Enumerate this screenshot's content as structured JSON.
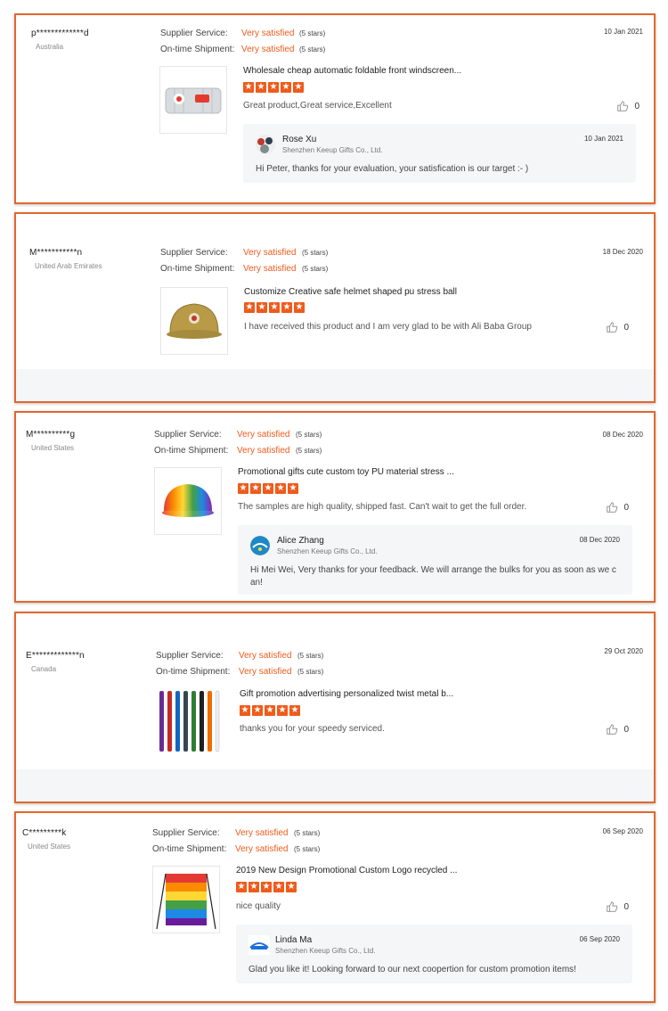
{
  "common": {
    "supplier_label": "Supplier Service:",
    "shipment_label": "On-time Shipment:",
    "satisfied": "Very satisfied",
    "stars_note": "(5 stars)",
    "star_glyph": "★",
    "like_icon": "thumbs-up-icon",
    "accent_color": "#ef5b1c",
    "border_color": "#e2672e"
  },
  "reviews": [
    {
      "user": "p*************d",
      "country": "Australia",
      "date": "10 Jan 2021",
      "product": "Wholesale cheap automatic foldable front windscreen...",
      "comment": "Great product,Great service,Excellent",
      "likes": "0",
      "reply": {
        "name": "Rose Xu",
        "company": "Shenzhen Keeup Gifts Co., Ltd.",
        "date": "10 Jan 2021",
        "text": "Hi Peter, thanks for your evaluation, your satisfication is our target :- )"
      }
    },
    {
      "user": "M***********n",
      "country": "United Arab Emirates",
      "date": "18 Dec 2020",
      "product": "Customize Creative safe helmet shaped pu stress ball",
      "comment": "I have received this product and I am very glad to be with Ali Baba Group",
      "likes": "0"
    },
    {
      "user": "M**********g",
      "country": "United States",
      "date": "08 Dec 2020",
      "product": "Promotional gifts cute custom toy PU material stress ...",
      "comment": "The samples are high quality, shipped fast. Can't wait to get the full order.",
      "likes": "0",
      "reply": {
        "name": "Alice Zhang",
        "company": "Shenzhen Keeup Gifts Co., Ltd.",
        "date": "08 Dec 2020",
        "text": "Hi Mei Wei, Very thanks for your feedback. We will arrange the bulks for you as soon as we can!"
      }
    },
    {
      "user": "E*************n",
      "country": "Canada",
      "date": "29 Oct 2020",
      "product": "Gift promotion advertising personalized twist metal b...",
      "comment": "thanks you for your speedy serviced.",
      "likes": "0"
    },
    {
      "user": "C*********k",
      "country": "United States",
      "date": "06 Sep 2020",
      "product": "2019 New Design Promotional Custom Logo recycled ...",
      "comment": "nice quality",
      "likes": "0",
      "reply": {
        "name": "Linda Ma",
        "company": "Shenzhen Keeup Gifts Co., Ltd.",
        "date": "06 Sep 2020",
        "text": "Glad you like it! Looking forward to our next coopertion for custom promotion items!"
      }
    }
  ]
}
